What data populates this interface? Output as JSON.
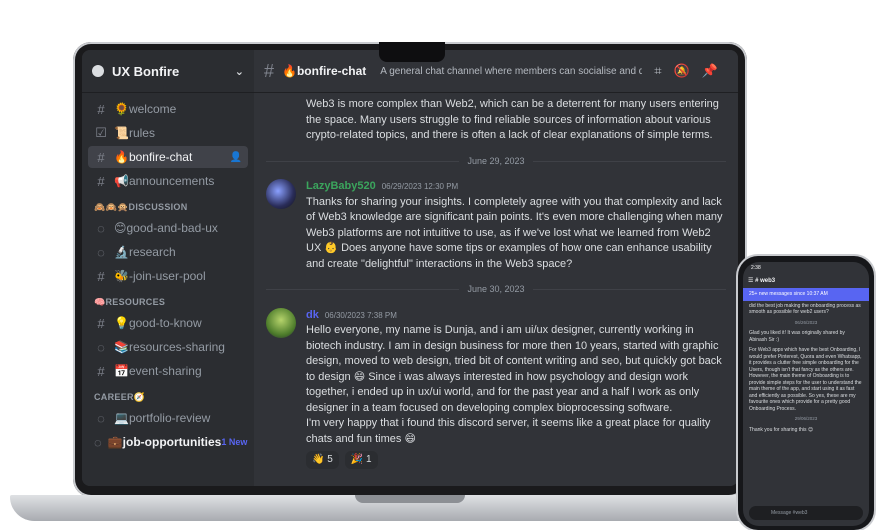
{
  "server": {
    "name": "UX Bonfire"
  },
  "sidebar": {
    "channels_top": [
      {
        "icon": "#",
        "label": "🌻welcome"
      },
      {
        "icon": "☑",
        "label": "📜rules"
      },
      {
        "icon": "#",
        "label": "🔥bonfire-chat",
        "active": true
      },
      {
        "icon": "#",
        "label": "📢announcements"
      }
    ],
    "cat1": "🙈🙉🙊DISCUSSION",
    "channels_disc": [
      {
        "icon": "💬",
        "label": "😊good-and-bad-ux"
      },
      {
        "icon": "💬",
        "label": "🔬research"
      },
      {
        "icon": "#",
        "label": "🐝-join-user-pool"
      }
    ],
    "cat2": "🧠RESOURCES",
    "channels_res": [
      {
        "icon": "#",
        "label": "💡good-to-know"
      },
      {
        "icon": "💬",
        "label": "📚resources-sharing"
      },
      {
        "icon": "#",
        "label": "📅event-sharing"
      }
    ],
    "cat3": "CAREER🧭",
    "channels_car": [
      {
        "icon": "💬",
        "label": "💻portfolio-review"
      },
      {
        "icon": "💬",
        "label": "💼job-opportunities",
        "badge": "1 New"
      }
    ]
  },
  "topbar": {
    "channel": "🔥bonfire-chat",
    "topic": "A general chat channel where members can socialise and dis..."
  },
  "messages": {
    "prev_text": "Web3 is more complex than Web2, which can be a deterrent for many users entering the space. Many users struggle to find reliable sources of information about various crypto-related topics, and there is often a lack of clear explanations of simple terms.",
    "date1": "June 29, 2023",
    "m1": {
      "user": "LazyBaby520",
      "time": "06/29/2023 12:30 PM",
      "text": "Thanks for sharing your insights. I completely agree with you that complexity and lack of Web3 knowledge are significant pain points. It's even more challenging when many Web3 platforms are not intuitive to use, as if we've lost what we learned from Web2 UX 👶  Does anyone have some tips or examples of how one can enhance usability and create \"delightful\" interactions in the Web3 space?"
    },
    "date2": "June 30, 2023",
    "m2": {
      "user": "dk",
      "time": "06/30/2023 7:38 PM",
      "text1": "Hello everyone, my name is Dunja, and i am ui/ux designer, currently working in biotech industry. I am in design business for more then 10 years, started with graphic design, moved to web design, tried bit of content writing and seo, but quickly got back to design 😄 Since i was always interested in how psychology and design work together, i ended up in ux/ui world, and for the past year and a half I work as only designer in a team focused on developing complex bioprocessing software.",
      "text2": "I'm very happy that i found this discord server, it seems like a great place for quality chats and fun times 😄",
      "reactions": [
        {
          "emoji": "👋",
          "count": "5"
        },
        {
          "emoji": "🎉",
          "count": "1"
        }
      ]
    }
  },
  "phone": {
    "time": "2:38",
    "channel": "web3",
    "banner": "25+ new messages since 10:37 AM",
    "lines": [
      "did the best job making the onboarding process as smooth as possible for web2 users?",
      "06/26/2023",
      "Glad you liked it! It was originally shared by Abinash Sir :)",
      "For Web3 apps which have the best Onboarding, I would prefer Pinterest, Quora and even Whatsapp, it provides a clutter free simple onboarding for the Users, though isn't that fancy as the others are. However, the main theme of Onboarding is to provide simple steps for the user to understand the main theme of the app, and start using it as fast and efficiently as possible. So yes, these are my favourite ones which provide for a pretty good Onboarding Process.",
      "29/06/2023",
      "Thank you for sharing this 😊"
    ],
    "input_placeholder": "Message #web3"
  },
  "colors": {
    "accent": "#5865f2",
    "user1": "#3ba55d",
    "user2": "#5865f2"
  }
}
